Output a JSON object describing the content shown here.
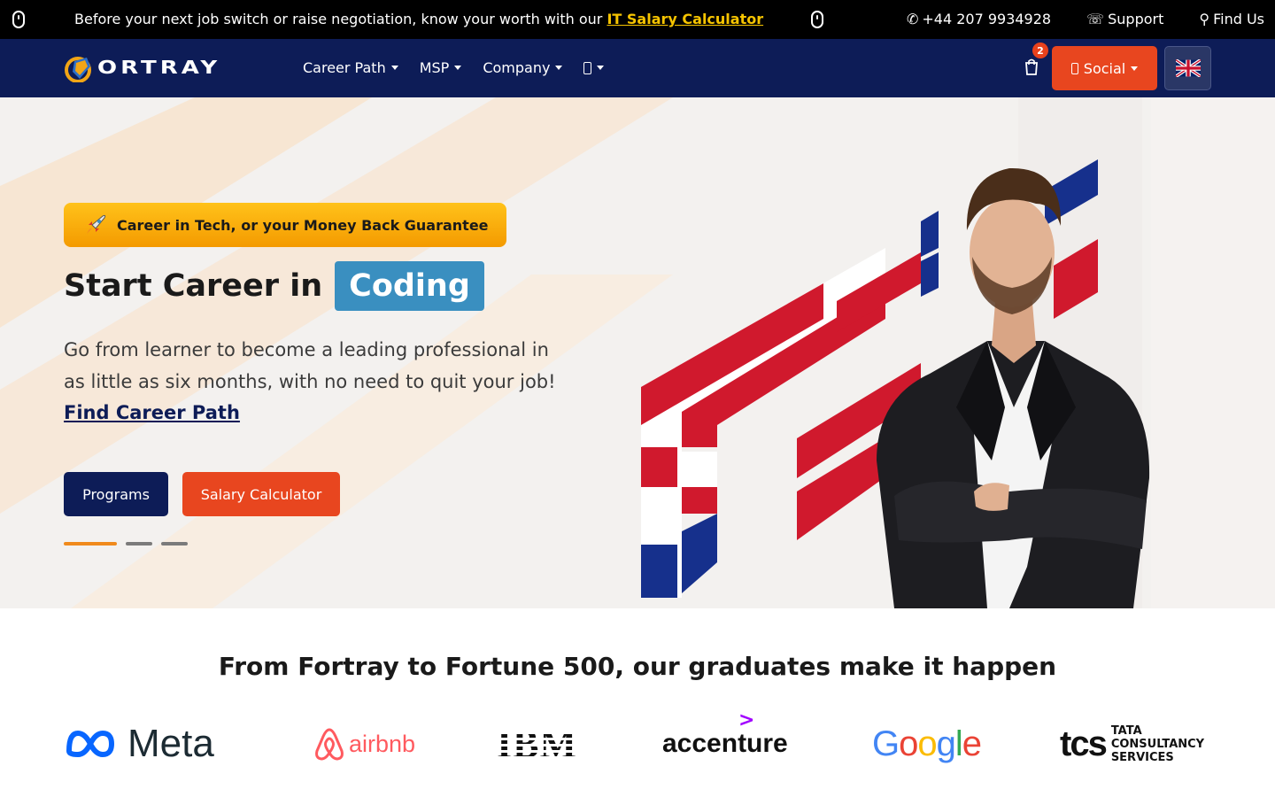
{
  "topbar": {
    "message": "Before your next job switch or raise negotiation, know your worth with our ",
    "link": "IT Salary Calculator",
    "phone": "+44 207 9934928",
    "support": "Support",
    "find_us": "Find Us",
    "icons": {
      "left": "mouse-icon",
      "right": "mouse-icon",
      "phone": "phone-icon",
      "support": "headset-icon",
      "find": "map-pin-icon"
    }
  },
  "nav": {
    "logo_text": "ORTRAY",
    "menu": [
      "Career Path",
      "MSP",
      "Company"
    ],
    "more_icon": "more-icon",
    "cart_count": "2",
    "social_label": "Social",
    "language": "English (UK)"
  },
  "hero": {
    "badge": "Career in Tech, or your Money Back Guarantee",
    "title_prefix": "Start Career in",
    "title_highlight": "Coding",
    "lead": "Go from learner to become a leading professional in as little as six months, with no need to quit your job! ",
    "lead_link": "Find Career Path",
    "btn_programs": "Programs",
    "btn_salary": "Salary Calculator",
    "slides": 3,
    "active_slide": 1
  },
  "partners": {
    "title": "From Fortray to Fortune 500, our graduates make it happen",
    "logos": [
      "Meta",
      "airbnb",
      "IBM",
      "accenture",
      "Google",
      "TATA CONSULTANCY SERVICES"
    ]
  },
  "colors": {
    "topbar_bg": "#000000",
    "nav_bg": "#0d1c57",
    "accent_orange": "#e8461f",
    "badge_yellow": "#ffc21a",
    "highlight_blue": "#3a8fc0",
    "link_yellow": "#f6c400"
  }
}
